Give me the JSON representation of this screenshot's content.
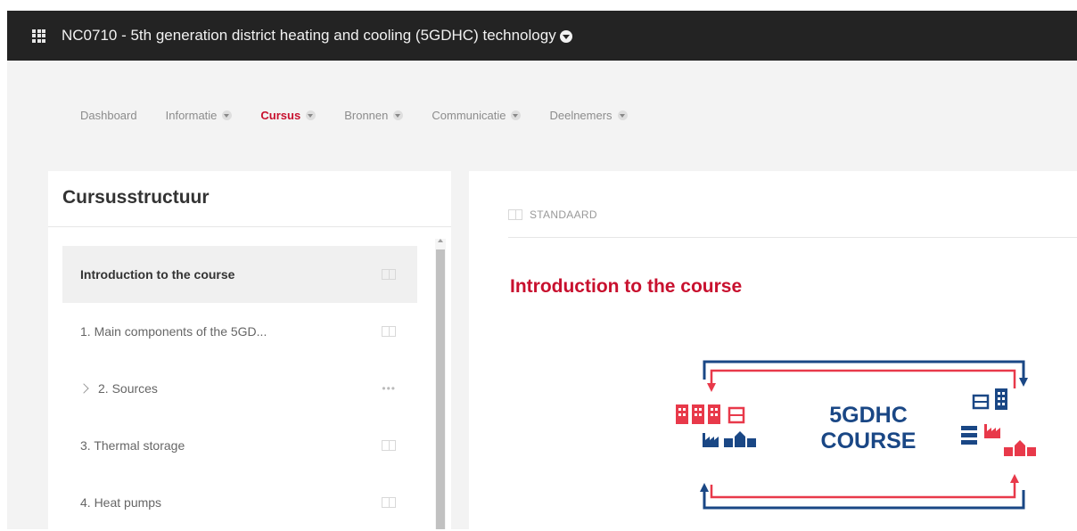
{
  "header": {
    "title": "NC0710 - 5th generation district heating and cooling (5GDHC) technology"
  },
  "nav": {
    "items": [
      {
        "label": "Dashboard",
        "dropdown": false,
        "active": false
      },
      {
        "label": "Informatie",
        "dropdown": true,
        "active": false
      },
      {
        "label": "Cursus",
        "dropdown": true,
        "active": true
      },
      {
        "label": "Bronnen",
        "dropdown": true,
        "active": false
      },
      {
        "label": "Communicatie",
        "dropdown": true,
        "active": false
      },
      {
        "label": "Deelnemers",
        "dropdown": true,
        "active": false
      }
    ]
  },
  "sidebar": {
    "title": "Cursusstructuur",
    "items": [
      {
        "label": "Introduction to the course",
        "icon": "book-icon",
        "selected": true
      },
      {
        "label": "1. Main components of the 5GD...",
        "icon": "book-icon",
        "selected": false
      },
      {
        "label": "2. Sources",
        "icon": "more-dots-icon",
        "selected": false,
        "expandable": true
      },
      {
        "label": "3. Thermal storage",
        "icon": "book-icon",
        "selected": false
      },
      {
        "label": "4. Heat pumps",
        "icon": "book-icon",
        "selected": false
      }
    ]
  },
  "main": {
    "type_label": "STANDAARD",
    "lesson_title": "Introduction to the course",
    "logo": {
      "line1": "5GDHC",
      "line2": "COURSE"
    }
  },
  "colors": {
    "accent": "#c8102e",
    "topbar": "#232323",
    "logo_blue": "#1a4785",
    "logo_red": "#e8394a"
  }
}
